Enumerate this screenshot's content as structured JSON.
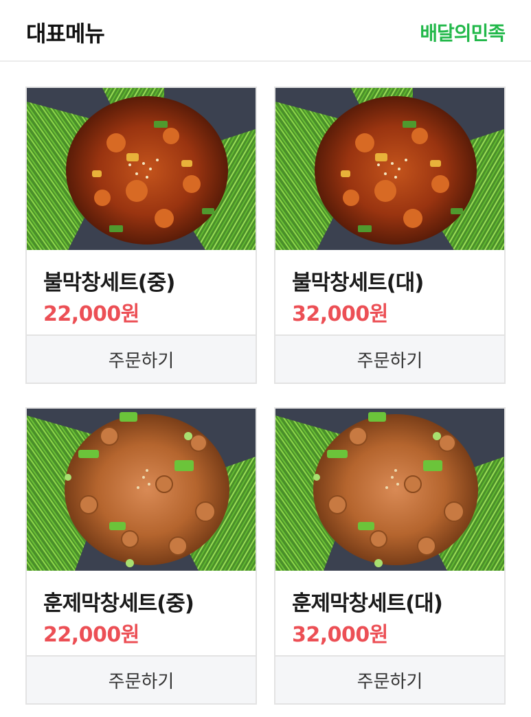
{
  "header": {
    "title": "대표메뉴",
    "brand": "배달의민족",
    "brand_color": "#22b84a"
  },
  "menu": [
    {
      "name": "불막창세트(중)",
      "price": "22,000원",
      "order_label": "주문하기",
      "photo": "spicy-grilled-gopchang-photo"
    },
    {
      "name": "불막창세트(대)",
      "price": "32,000원",
      "order_label": "주문하기",
      "photo": "spicy-grilled-gopchang-photo"
    },
    {
      "name": "훈제막창세트(중)",
      "price": "22,000원",
      "order_label": "주문하기",
      "photo": "smoked-gopchang-photo"
    },
    {
      "name": "훈제막창세트(대)",
      "price": "32,000원",
      "order_label": "주문하기",
      "photo": "smoked-gopchang-photo"
    }
  ],
  "colors": {
    "price": "#ec4f55",
    "button_bg": "#f5f6f8",
    "border": "#e3e3e3"
  }
}
